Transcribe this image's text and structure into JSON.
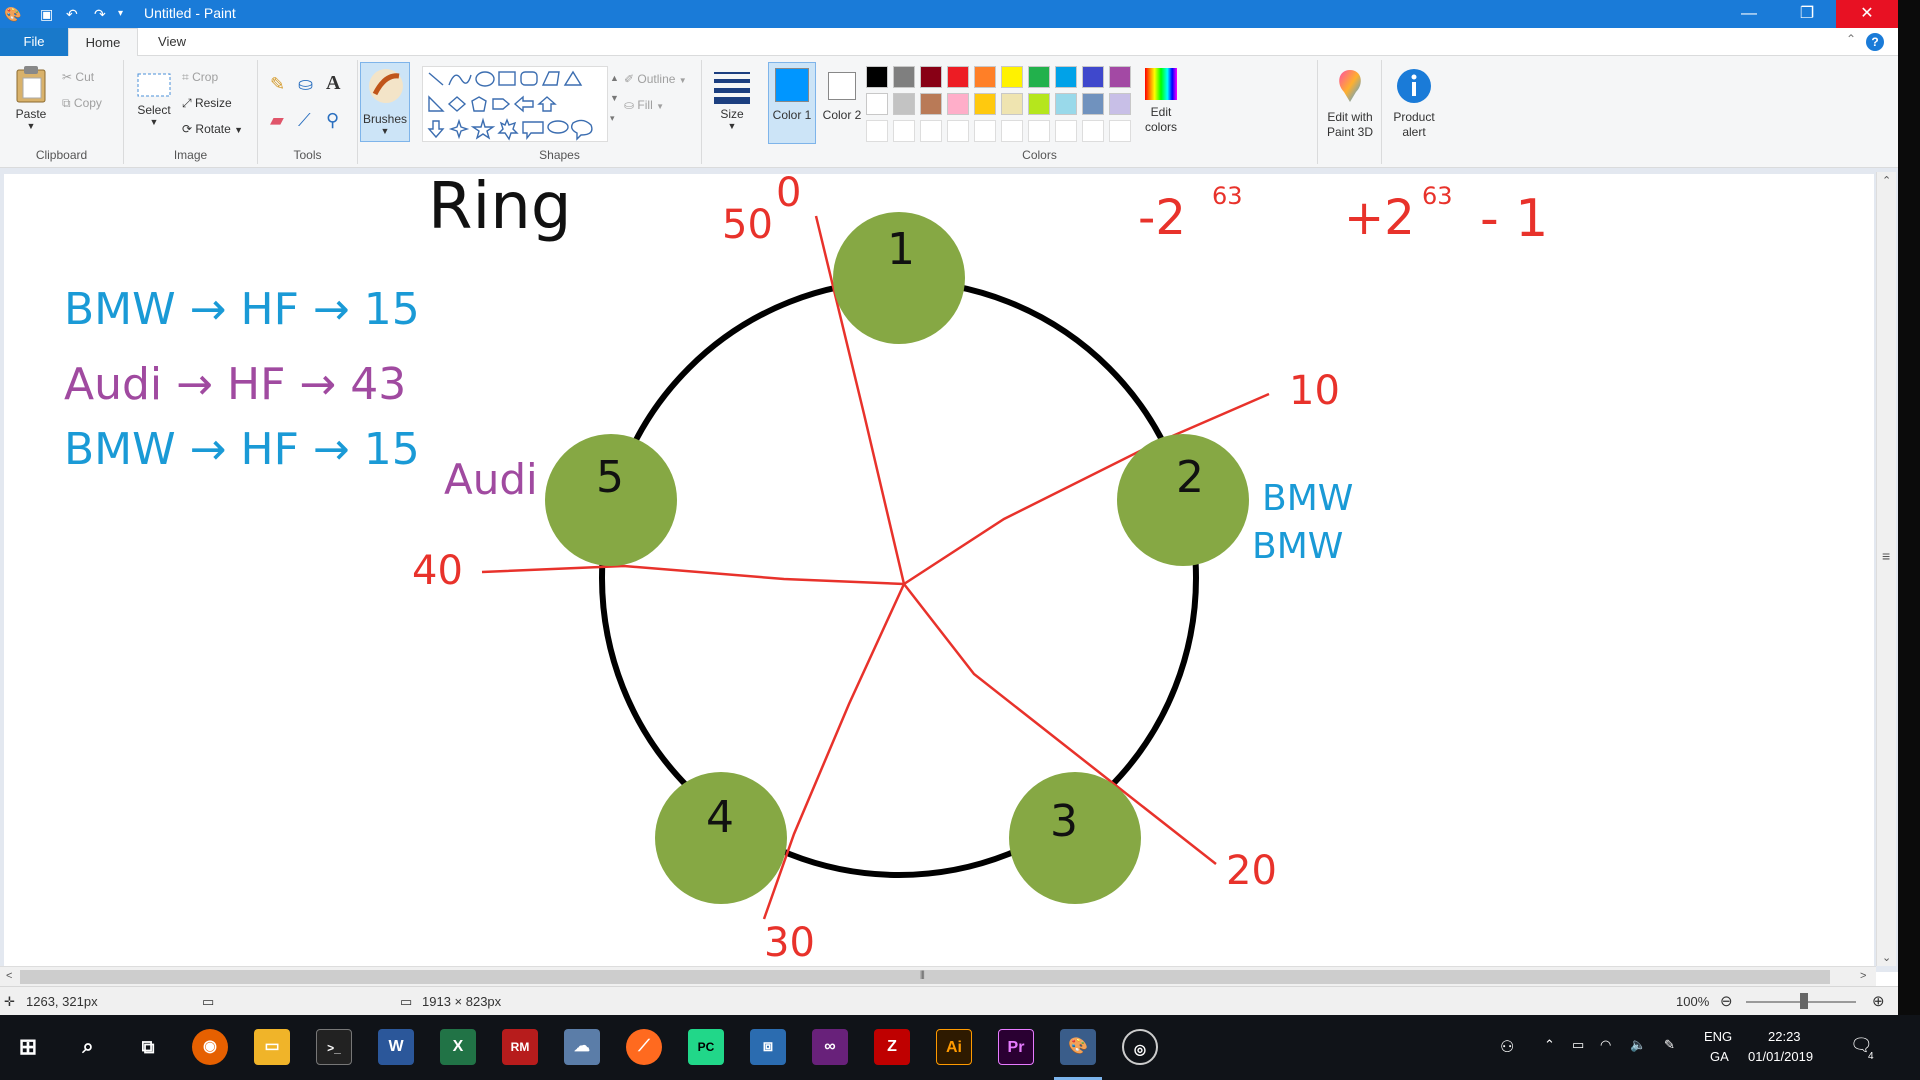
{
  "titlebar": {
    "title": "Untitled - Paint",
    "minimize": "—",
    "restore": "❐",
    "close": "✕"
  },
  "tabs": {
    "file": "File",
    "home": "Home",
    "view": "View"
  },
  "ribbon": {
    "clipboard": {
      "label": "Clipboard",
      "paste": "Paste",
      "cut": "Cut",
      "copy": "Copy"
    },
    "image": {
      "label": "Image",
      "select": "Select",
      "crop": "Crop",
      "resize": "Resize",
      "rotate": "Rotate"
    },
    "tools": {
      "label": "Tools"
    },
    "brushes": {
      "label": "Brushes"
    },
    "shapes": {
      "label": "Shapes",
      "outline": "Outline",
      "fill": "Fill"
    },
    "size": {
      "label": "Size"
    },
    "colors": {
      "label": "Colors",
      "color1": "Color 1",
      "color2": "Color 2",
      "edit_colors": "Edit colors",
      "color1_value": "#0096ff",
      "color2_value": "#ffffff",
      "palette_row1": [
        "#000000",
        "#7f7f7f",
        "#880015",
        "#ed1c24",
        "#ff7f27",
        "#fff200",
        "#22b14c",
        "#00a2e8",
        "#3f48cc",
        "#a349a4"
      ],
      "palette_row2": [
        "#ffffff",
        "#c3c3c3",
        "#b97a57",
        "#ffaec9",
        "#ffc90e",
        "#efe4b0",
        "#b5e61d",
        "#99d9ea",
        "#7092be",
        "#c8bfe7"
      ]
    },
    "paint3d": "Edit with Paint 3D",
    "product_alert": "Product alert"
  },
  "drawing": {
    "title": "Ring",
    "hash_lines": [
      {
        "text": "BMW → HF → 15",
        "color": "#1a9ad6"
      },
      {
        "text": "Audi → HF → 43",
        "color": "#a04aa0"
      },
      {
        "text": "BMW → HF → 15",
        "color": "#1a9ad6"
      }
    ],
    "range_min_base": "-2",
    "range_min_exp": "63",
    "range_max_base": "+2",
    "range_max_exp": "63",
    "range_max_tail": "- 1",
    "nodes": [
      "1",
      "2",
      "3",
      "4",
      "5"
    ],
    "token_labels": [
      "50",
      "0",
      "10",
      "20",
      "30",
      "40"
    ],
    "node2_entries": [
      "BMW",
      "BMW"
    ],
    "node5_entry": "Audi",
    "node_color": "#86a844",
    "token_color": "#e8322b"
  },
  "status": {
    "cursor": "1263, 321px",
    "dimensions": "1913 × 823px",
    "zoom": "100%"
  },
  "taskbar": {
    "lang_top": "ENG",
    "lang_bottom": "GA",
    "time": "22:23",
    "date": "01/01/2019",
    "notification_count": "4"
  }
}
